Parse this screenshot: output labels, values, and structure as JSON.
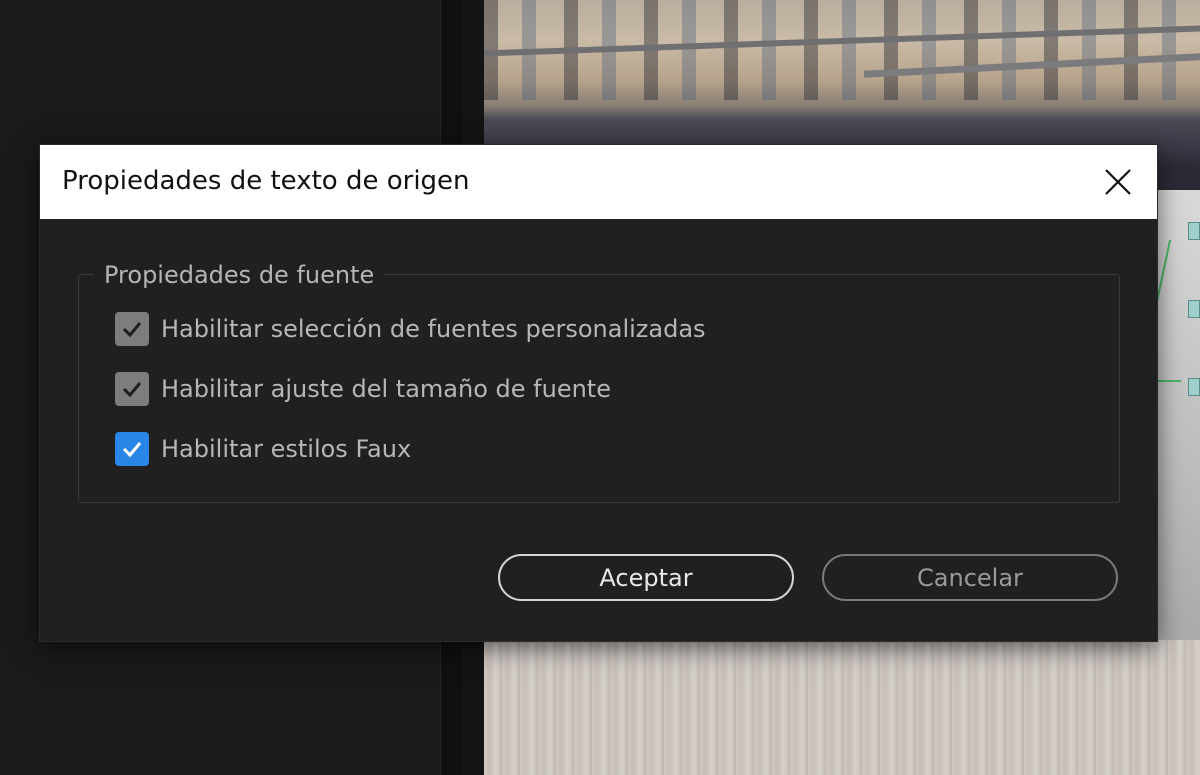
{
  "dialog": {
    "title": "Propiedades de texto de origen",
    "close_icon": "close-icon",
    "fieldset": {
      "legend": "Propiedades de fuente",
      "options": [
        {
          "label": "Habilitar selección de fuentes personalizadas",
          "checked": true,
          "enabled": false,
          "color": "#7d7d7d"
        },
        {
          "label": "Habilitar ajuste del tamaño de fuente",
          "checked": true,
          "enabled": false,
          "color": "#7d7d7d"
        },
        {
          "label": "Habilitar estilos Faux",
          "checked": true,
          "enabled": true,
          "color": "#2a86e6"
        }
      ]
    },
    "buttons": {
      "ok_label": "Aceptar",
      "cancel_label": "Cancelar"
    }
  },
  "colors": {
    "accent": "#2a86e6",
    "dialog_bg": "#202020",
    "titlebar_bg": "#ffffff"
  }
}
